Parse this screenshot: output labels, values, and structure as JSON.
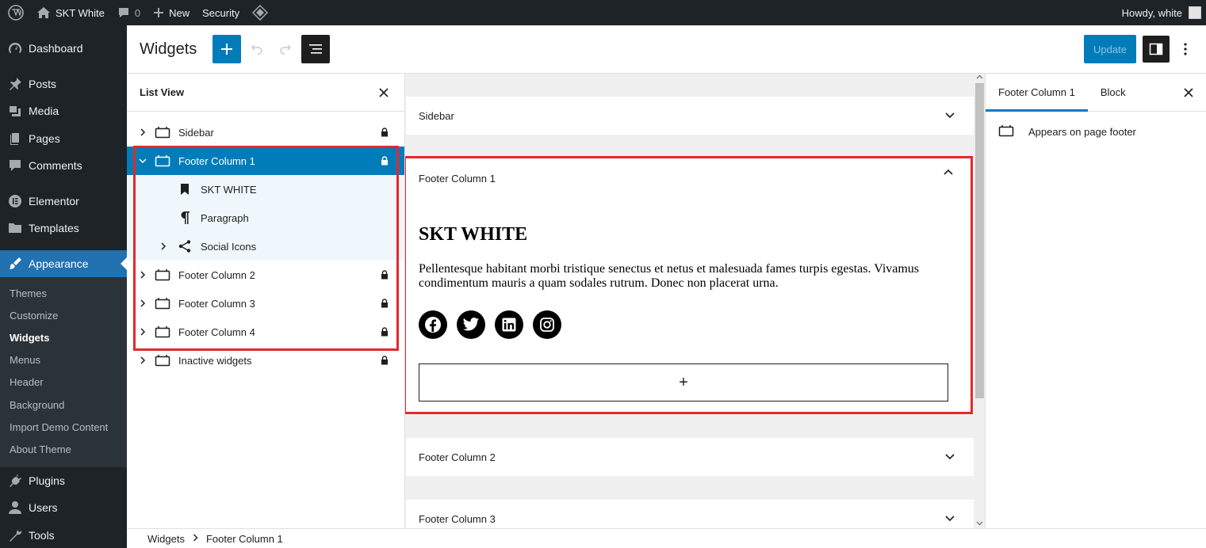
{
  "adminbar": {
    "site_name": "SKT White",
    "comments_count": "0",
    "new_label": "New",
    "security_label": "Security",
    "howdy": "Howdy, white"
  },
  "adminmenu": {
    "items": [
      {
        "label": "Dashboard",
        "icon": "dashboard-icon"
      },
      {
        "label": "Posts",
        "icon": "pin-icon"
      },
      {
        "label": "Media",
        "icon": "media-icon"
      },
      {
        "label": "Pages",
        "icon": "pages-icon"
      },
      {
        "label": "Comments",
        "icon": "comment-icon"
      },
      {
        "label": "Elementor",
        "icon": "elementor-icon"
      },
      {
        "label": "Templates",
        "icon": "folder-icon"
      },
      {
        "label": "Appearance",
        "icon": "brush-icon"
      }
    ],
    "appearance_sub": [
      "Themes",
      "Customize",
      "Widgets",
      "Menus",
      "Header",
      "Background",
      "Import Demo Content",
      "About Theme"
    ],
    "items_after": [
      {
        "label": "Plugins",
        "icon": "plugin-icon"
      },
      {
        "label": "Users",
        "icon": "users-icon"
      },
      {
        "label": "Tools",
        "icon": "tools-icon"
      }
    ]
  },
  "header": {
    "title": "Widgets",
    "update_label": "Update"
  },
  "listview": {
    "title": "List View",
    "rows": [
      {
        "label": "Sidebar"
      },
      {
        "label": "Footer Column 1"
      },
      {
        "label": "SKT WHITE"
      },
      {
        "label": "Paragraph"
      },
      {
        "label": "Social Icons"
      },
      {
        "label": "Footer Column 2"
      },
      {
        "label": "Footer Column 3"
      },
      {
        "label": "Footer Column 4"
      },
      {
        "label": "Inactive widgets"
      }
    ]
  },
  "canvas": {
    "sidebar_title": "Sidebar",
    "footer1_title": "Footer Column 1",
    "widget_heading": "SKT WHITE",
    "widget_paragraph": "Pellentesque habitant morbi tristique senectus et netus et malesuada fames turpis egestas. Vivamus condimentum mauris a quam sodales rutrum. Donec non placerat urna.",
    "social_icons": [
      "facebook-icon",
      "twitter-icon",
      "linkedin-icon",
      "instagram-icon"
    ],
    "appender_symbol": "+",
    "footer2_title": "Footer Column 2",
    "footer3_title": "Footer Column 3"
  },
  "settings": {
    "tab_area": "Footer Column 1",
    "tab_block": "Block",
    "description": "Appears on page footer"
  },
  "breadcrumbs": {
    "root": "Widgets",
    "current": "Footer Column 1"
  },
  "colors": {
    "accent": "#007cba",
    "admin_dark": "#1d2327",
    "menu_current": "#2271b1",
    "highlight": "#e5282c"
  }
}
